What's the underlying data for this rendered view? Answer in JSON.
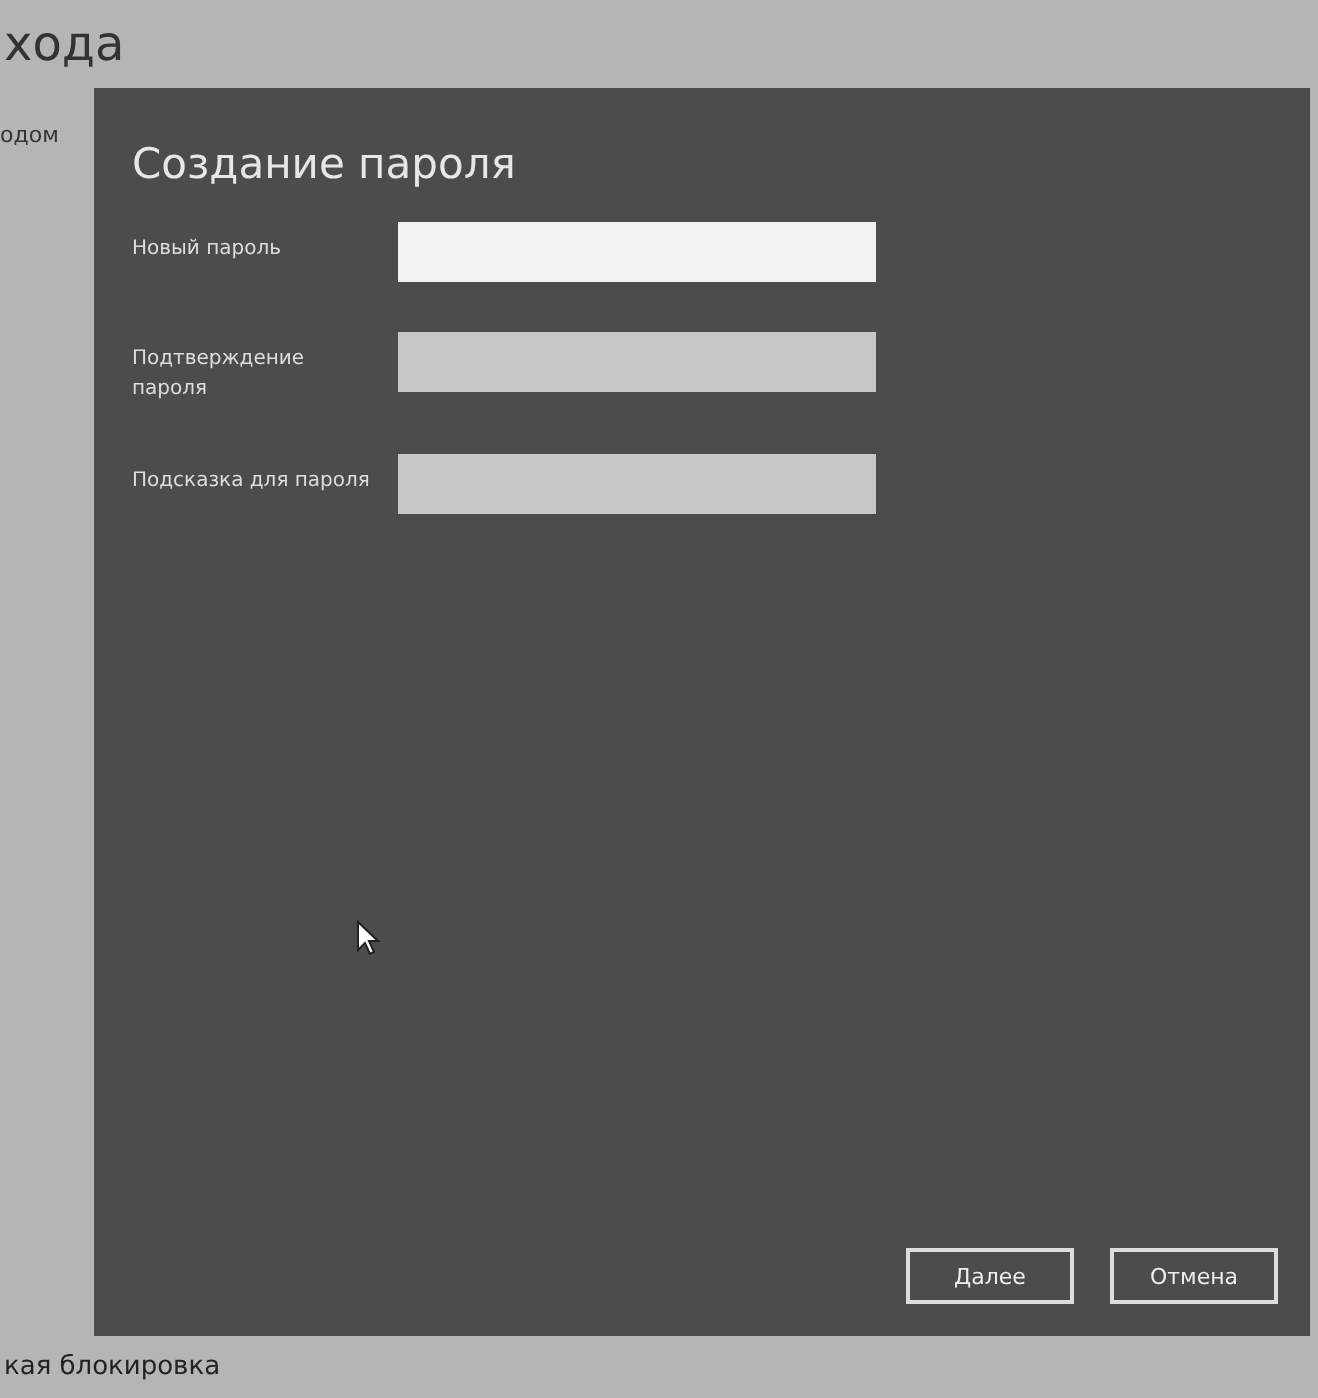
{
  "background_page": {
    "heading": "хода",
    "side_text": "одом",
    "footer_heading": "кая блокировка"
  },
  "dialog": {
    "title": "Создание пароля",
    "fields": [
      {
        "label": "Новый пароль",
        "focused": true
      },
      {
        "label": "Подтверждение пароля",
        "focused": false
      },
      {
        "label": "Подсказка для пароля",
        "focused": false
      }
    ],
    "buttons": [
      "Далее",
      "Отмена"
    ]
  }
}
